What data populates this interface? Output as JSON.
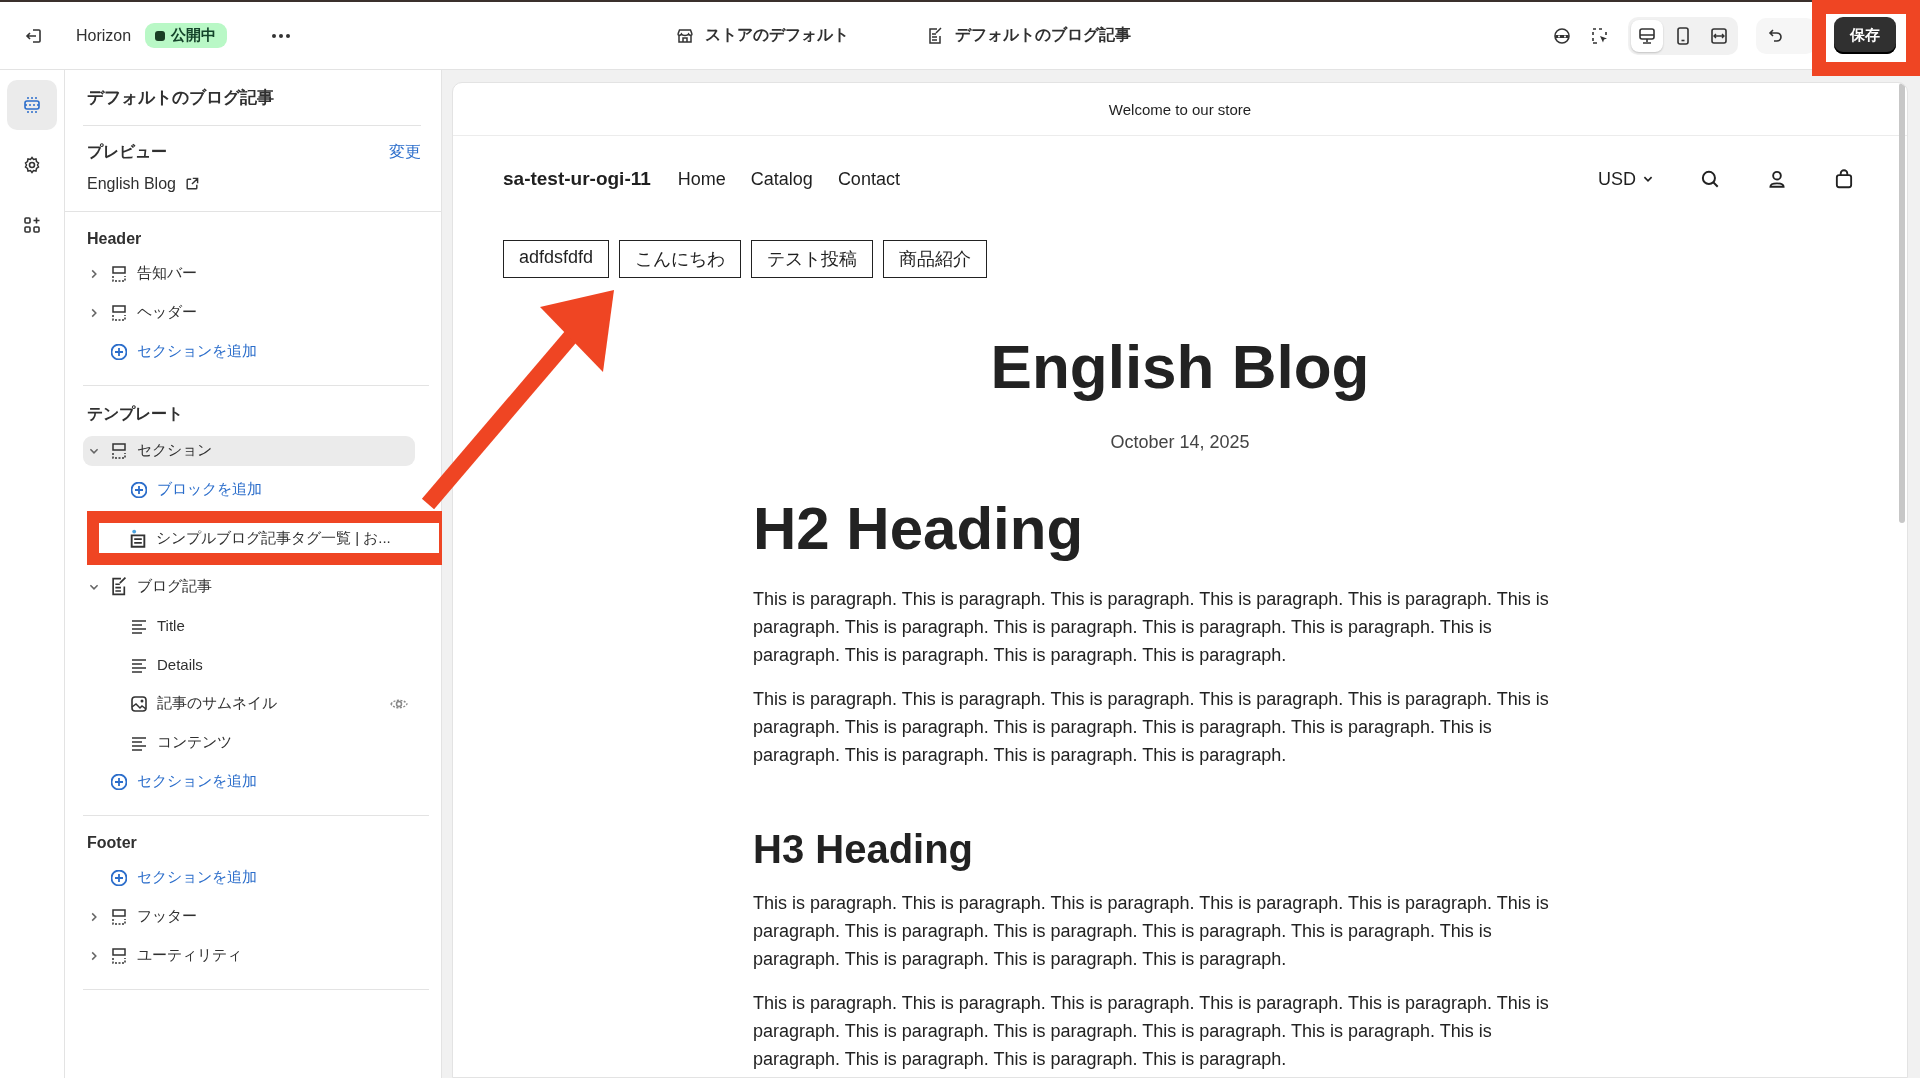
{
  "topbar": {
    "theme_name": "Horizon",
    "status": {
      "label": "公開中",
      "color": "#1a3d24"
    },
    "center_tabs": [
      {
        "kind": "store",
        "label": "ストアのデフォルト"
      },
      {
        "kind": "template",
        "label": "デフォルトのブログ記事"
      }
    ],
    "devices": [
      {
        "kind": "desktop",
        "selected": true
      },
      {
        "kind": "mobile",
        "selected": false
      },
      {
        "kind": "fullwidth",
        "selected": false
      }
    ],
    "save_label": "保存"
  },
  "sidebar": {
    "title": "デフォルトのブログ記事",
    "preview": {
      "label": "プレビュー",
      "change_label": "変更",
      "value": "English Blog"
    },
    "groups": [
      {
        "title": "Header",
        "items": [
          {
            "kind": "section",
            "label": "告知バー",
            "expanded": false,
            "selected": false
          },
          {
            "kind": "section",
            "label": "ヘッダー",
            "expanded": false,
            "selected": false
          },
          {
            "kind": "add",
            "label": "セクションを追加"
          }
        ]
      },
      {
        "title": "テンプレート",
        "items": [
          {
            "kind": "section",
            "label": "セクション",
            "expanded": true,
            "selected": true,
            "children": [
              {
                "kind": "add",
                "label": "ブロックを追加"
              },
              {
                "kind": "app",
                "label": "シンプルブログ記事タグ一覧 | お...",
                "selected": false,
                "highlighted": true
              }
            ]
          },
          {
            "kind": "post",
            "label": "ブログ記事",
            "expanded": true,
            "selected": false,
            "children": [
              {
                "kind": "text",
                "label": "Title",
                "selected": false
              },
              {
                "kind": "text",
                "label": "Details",
                "selected": false
              },
              {
                "kind": "image",
                "label": "記事のサムネイル",
                "selected": false,
                "visibility_toggle": true
              },
              {
                "kind": "text",
                "label": "コンテンツ",
                "selected": false
              }
            ]
          },
          {
            "kind": "add",
            "label": "セクションを追加"
          }
        ]
      },
      {
        "title": "Footer",
        "items": [
          {
            "kind": "add",
            "label": "セクションを追加"
          },
          {
            "kind": "section",
            "label": "フッター",
            "expanded": false,
            "selected": false
          },
          {
            "kind": "section",
            "label": "ユーティリティ",
            "expanded": false,
            "selected": false
          }
        ]
      }
    ]
  },
  "preview": {
    "announcement": "Welcome to our store",
    "brand": "sa-test-ur-ogi-11",
    "nav": [
      "Home",
      "Catalog",
      "Contact"
    ],
    "currency": "USD",
    "tags": [
      "adfdsfdfd",
      "こんにちわ",
      "テスト投稿",
      "商品紹介"
    ],
    "article": {
      "title": "English Blog",
      "date": "October 14, 2025",
      "blocks": [
        {
          "kind": "h2",
          "text": "H2 Heading"
        },
        {
          "kind": "p",
          "text": "This is paragraph. This is paragraph. This is paragraph. This is paragraph. This is paragraph. This is paragraph. This is paragraph. This is paragraph. This is paragraph. This is paragraph. This is paragraph. This is paragraph. This is paragraph. This is paragraph."
        },
        {
          "kind": "p",
          "text": "This is paragraph. This is paragraph. This is paragraph. This is paragraph. This is paragraph. This is paragraph. This is paragraph. This is paragraph. This is paragraph. This is paragraph. This is paragraph. This is paragraph. This is paragraph. This is paragraph."
        },
        {
          "kind": "h3",
          "text": "H3 Heading"
        },
        {
          "kind": "p",
          "text": "This is paragraph. This is paragraph. This is paragraph. This is paragraph. This is paragraph. This is paragraph. This is paragraph. This is paragraph. This is paragraph. This is paragraph. This is paragraph. This is paragraph. This is paragraph. This is paragraph."
        },
        {
          "kind": "p",
          "text": "This is paragraph. This is paragraph. This is paragraph. This is paragraph. This is paragraph. This is paragraph. This is paragraph. This is paragraph. This is paragraph. This is paragraph. This is paragraph. This is paragraph. This is paragraph. This is paragraph."
        }
      ]
    }
  }
}
